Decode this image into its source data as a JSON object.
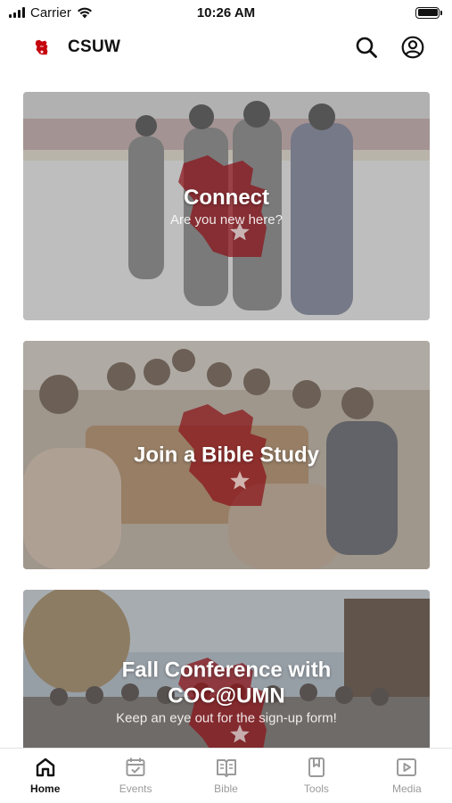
{
  "status_bar": {
    "carrier": "Carrier",
    "time": "10:26 AM"
  },
  "header": {
    "title": "CSUW",
    "logo_icon": "wisconsin-logo-icon",
    "brand_color": "#c5050c"
  },
  "cards": [
    {
      "title": "Connect",
      "subtitle": "Are you new here?"
    },
    {
      "title": "Join a Bible Study",
      "subtitle": ""
    },
    {
      "title": "Fall Conference with COC@UMN",
      "subtitle": "Keep an eye out for the sign-up form!"
    }
  ],
  "tabs": [
    {
      "label": "Home",
      "icon": "home-icon",
      "active": true
    },
    {
      "label": "Events",
      "icon": "calendar-icon",
      "active": false
    },
    {
      "label": "Bible",
      "icon": "book-icon",
      "active": false
    },
    {
      "label": "Tools",
      "icon": "bookmark-icon",
      "active": false
    },
    {
      "label": "Media",
      "icon": "play-icon",
      "active": false
    }
  ],
  "colors": {
    "accent": "#c5050c",
    "card_mark": "#8b1218",
    "tab_inactive": "#9a9a9a",
    "tab_active": "#111111"
  }
}
